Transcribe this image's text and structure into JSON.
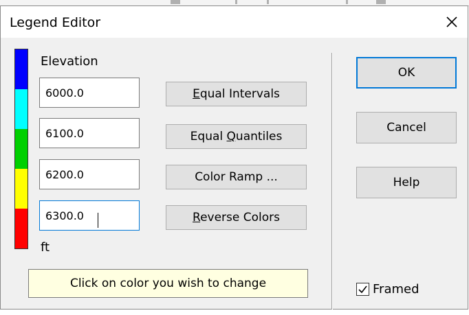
{
  "dialog": {
    "title": "Legend Editor"
  },
  "legend": {
    "header": "Elevation",
    "unit": "ft",
    "colors": [
      "#0000ff",
      "#00ffff",
      "#00d000",
      "#ffff00",
      "#ff0000"
    ],
    "colors_order": "top-to-bottom",
    "values": [
      "6000.0",
      "6100.0",
      "6200.0",
      "6300.0"
    ]
  },
  "buttons": {
    "equal_intervals": {
      "pre": "",
      "accel": "E",
      "post": "qual Intervals"
    },
    "equal_quantiles": {
      "pre": "Equal ",
      "accel": "Q",
      "post": "uantiles"
    },
    "color_ramp": "Color Ramp ...",
    "reverse_colors": {
      "pre": "",
      "accel": "R",
      "post": "everse Colors"
    },
    "ok": "OK",
    "cancel": "Cancel",
    "help": "Help"
  },
  "hint": "Click on color you wish to change",
  "framed": {
    "label": "Framed",
    "checked": true
  },
  "icons": {
    "close": "close-icon",
    "check": "checkmark-icon"
  }
}
